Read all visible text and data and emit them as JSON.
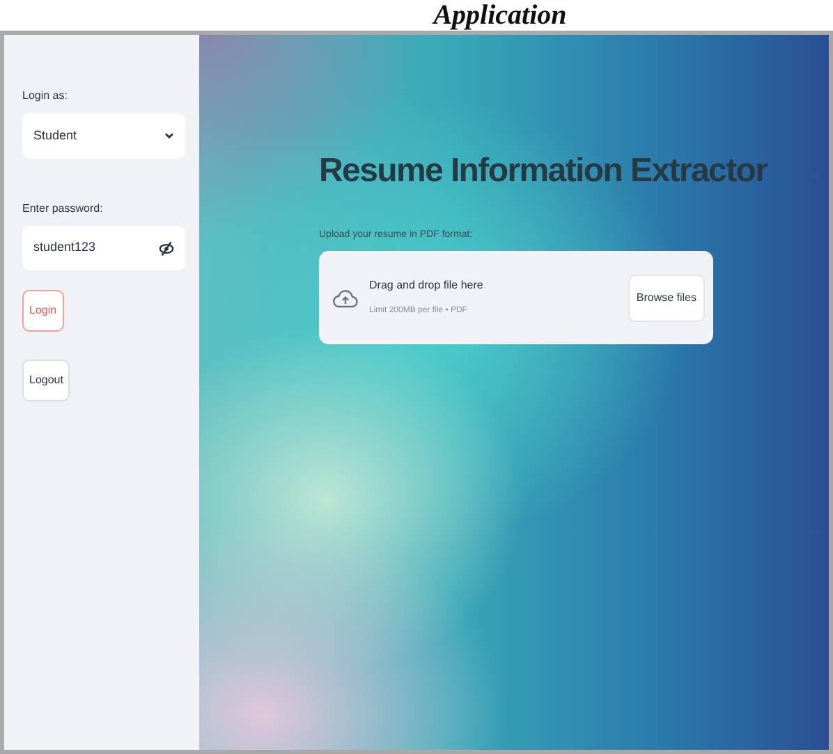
{
  "caption": "Application",
  "sidebar": {
    "role_label": "Login as:",
    "role_select": {
      "value": "Student"
    },
    "password_label": "Enter password:",
    "password_field": {
      "value": "student123"
    },
    "buttons": [
      {
        "label": "Login",
        "kind": "primary"
      },
      {
        "label": "Logout",
        "kind": "secondary"
      }
    ]
  },
  "main": {
    "title": "Resume Information Extractor",
    "upload_label": "Upload your resume in PDF format:",
    "dropzone": {
      "title": "Drag and drop file here",
      "hint": "Limit 200MB per file • PDF",
      "button": "Browse files"
    }
  }
}
